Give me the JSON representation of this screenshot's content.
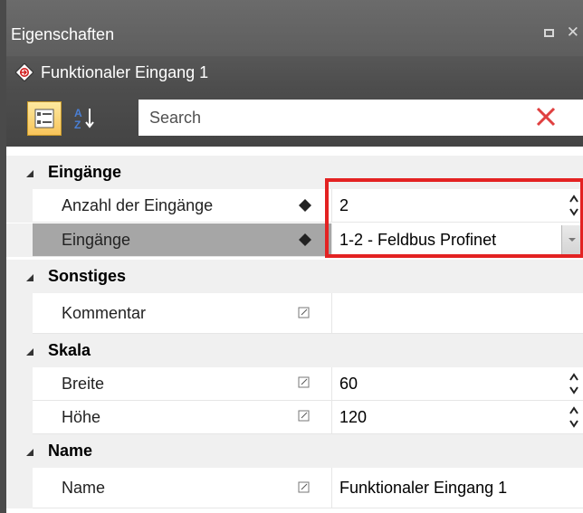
{
  "panel": {
    "title": "Eigenschaften"
  },
  "object": {
    "name": "Funktionaler Eingang 1"
  },
  "toolbar": {
    "search_placeholder": "Search"
  },
  "categories": [
    {
      "label": "Eingänge",
      "props": [
        {
          "name": "Anzahl der Eingänge",
          "value": "2",
          "editor": "spinner"
        },
        {
          "name": "Eingänge",
          "value": "1-2 - Feldbus Profinet",
          "editor": "dropdown",
          "selected": true
        }
      ]
    },
    {
      "label": "Sonstiges",
      "props": [
        {
          "name": "Kommentar",
          "value": "",
          "editor": "text"
        }
      ]
    },
    {
      "label": "Skala",
      "props": [
        {
          "name": "Breite",
          "value": "60",
          "editor": "spinner"
        },
        {
          "name": "Höhe",
          "value": "120",
          "editor": "spinner"
        }
      ]
    },
    {
      "label": "Name",
      "props": [
        {
          "name": "Name",
          "value": "Funktionaler Eingang 1",
          "editor": "text"
        }
      ]
    }
  ],
  "colors": {
    "highlight": "#e32222",
    "titlebar": "#5f5f5f",
    "selected_row": "#a6a6a6"
  }
}
